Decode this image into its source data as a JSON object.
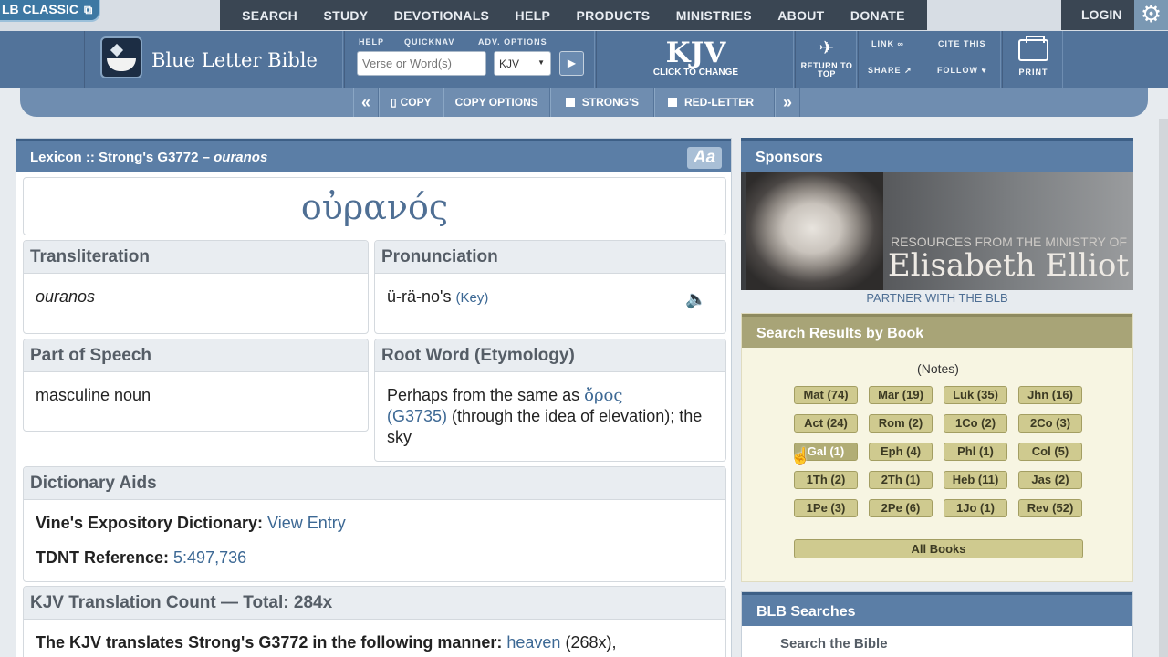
{
  "topnav": {
    "classic": "LB CLASSIC",
    "items": [
      "SEARCH",
      "STUDY",
      "DEVOTIONALS",
      "HELP",
      "PRODUCTS",
      "MINISTRIES",
      "ABOUT",
      "DONATE"
    ],
    "login": "LOGIN"
  },
  "header": {
    "logo_text": "Blue Letter Bible",
    "labels": {
      "help": "HELP",
      "quicknav": "QUICKNAV",
      "adv": "ADV. OPTIONS"
    },
    "search_placeholder": "Verse or Word(s)",
    "version": "KJV",
    "kjv_big": "KJV",
    "kjv_small": "CLICK TO CHANGE",
    "return_top": "RETURN TO TOP",
    "link": "LINK",
    "cite": "CITE THIS",
    "share": "SHARE",
    "follow": "FOLLOW",
    "print": "PRINT"
  },
  "toolbar": {
    "copy": "COPY",
    "copy_options": "COPY OPTIONS",
    "strongs": "STRONG'S",
    "red_letter": "RED-LETTER"
  },
  "lexicon": {
    "title_prefix": "Lexicon :: Strong's G3772 – ",
    "title_word": "ouranos",
    "font_btn": "Aa",
    "greek": "οὐρανός",
    "transliteration_label": "Transliteration",
    "transliteration": "ouranos",
    "pronunciation_label": "Pronunciation",
    "pronunciation": "ü-rä-no's",
    "key": "(Key)",
    "pos_label": "Part of Speech",
    "pos": "masculine noun",
    "root_label": "Root Word (Etymology)",
    "root_pre": "Perhaps from the same as ",
    "root_greek": "ὄρος",
    "root_ref": "(G3735)",
    "root_post": " (through the idea of elevation); the sky",
    "dict_label": "Dictionary Aids",
    "vines_label": "Vine's Expository Dictionary: ",
    "vines_link": "View Entry",
    "tdnt_label": "TDNT Reference: ",
    "tdnt_link": "5:497,736",
    "count_label": "KJV Translation Count — Total: 284x",
    "translates": "The KJV translates Strong's G3772 in the following manner: ",
    "heaven": "heaven",
    "heaven_count": " (268x),"
  },
  "sponsors": {
    "title": "Sponsors",
    "small": "RESOURCES FROM THE MINISTRY OF",
    "big": "Elisabeth Elliot",
    "partner": "PARTNER WITH THE BLB"
  },
  "results": {
    "title": "Search Results by Book",
    "notes": "(Notes)",
    "books": [
      "Mat (74)",
      "Mar (19)",
      "Luk (35)",
      "Jhn (16)",
      "Act (24)",
      "Rom (2)",
      "1Co (2)",
      "2Co (3)",
      "Gal (1)",
      "Eph (4)",
      "Phl (1)",
      "Col (5)",
      "1Th (2)",
      "2Th (1)",
      "Heb (11)",
      "Jas (2)",
      "1Pe (3)",
      "2Pe (6)",
      "1Jo (1)",
      "Rev (52)"
    ],
    "all": "All Books"
  },
  "blb_searches": {
    "title": "BLB Searches",
    "search_label": "Search the Bible"
  }
}
